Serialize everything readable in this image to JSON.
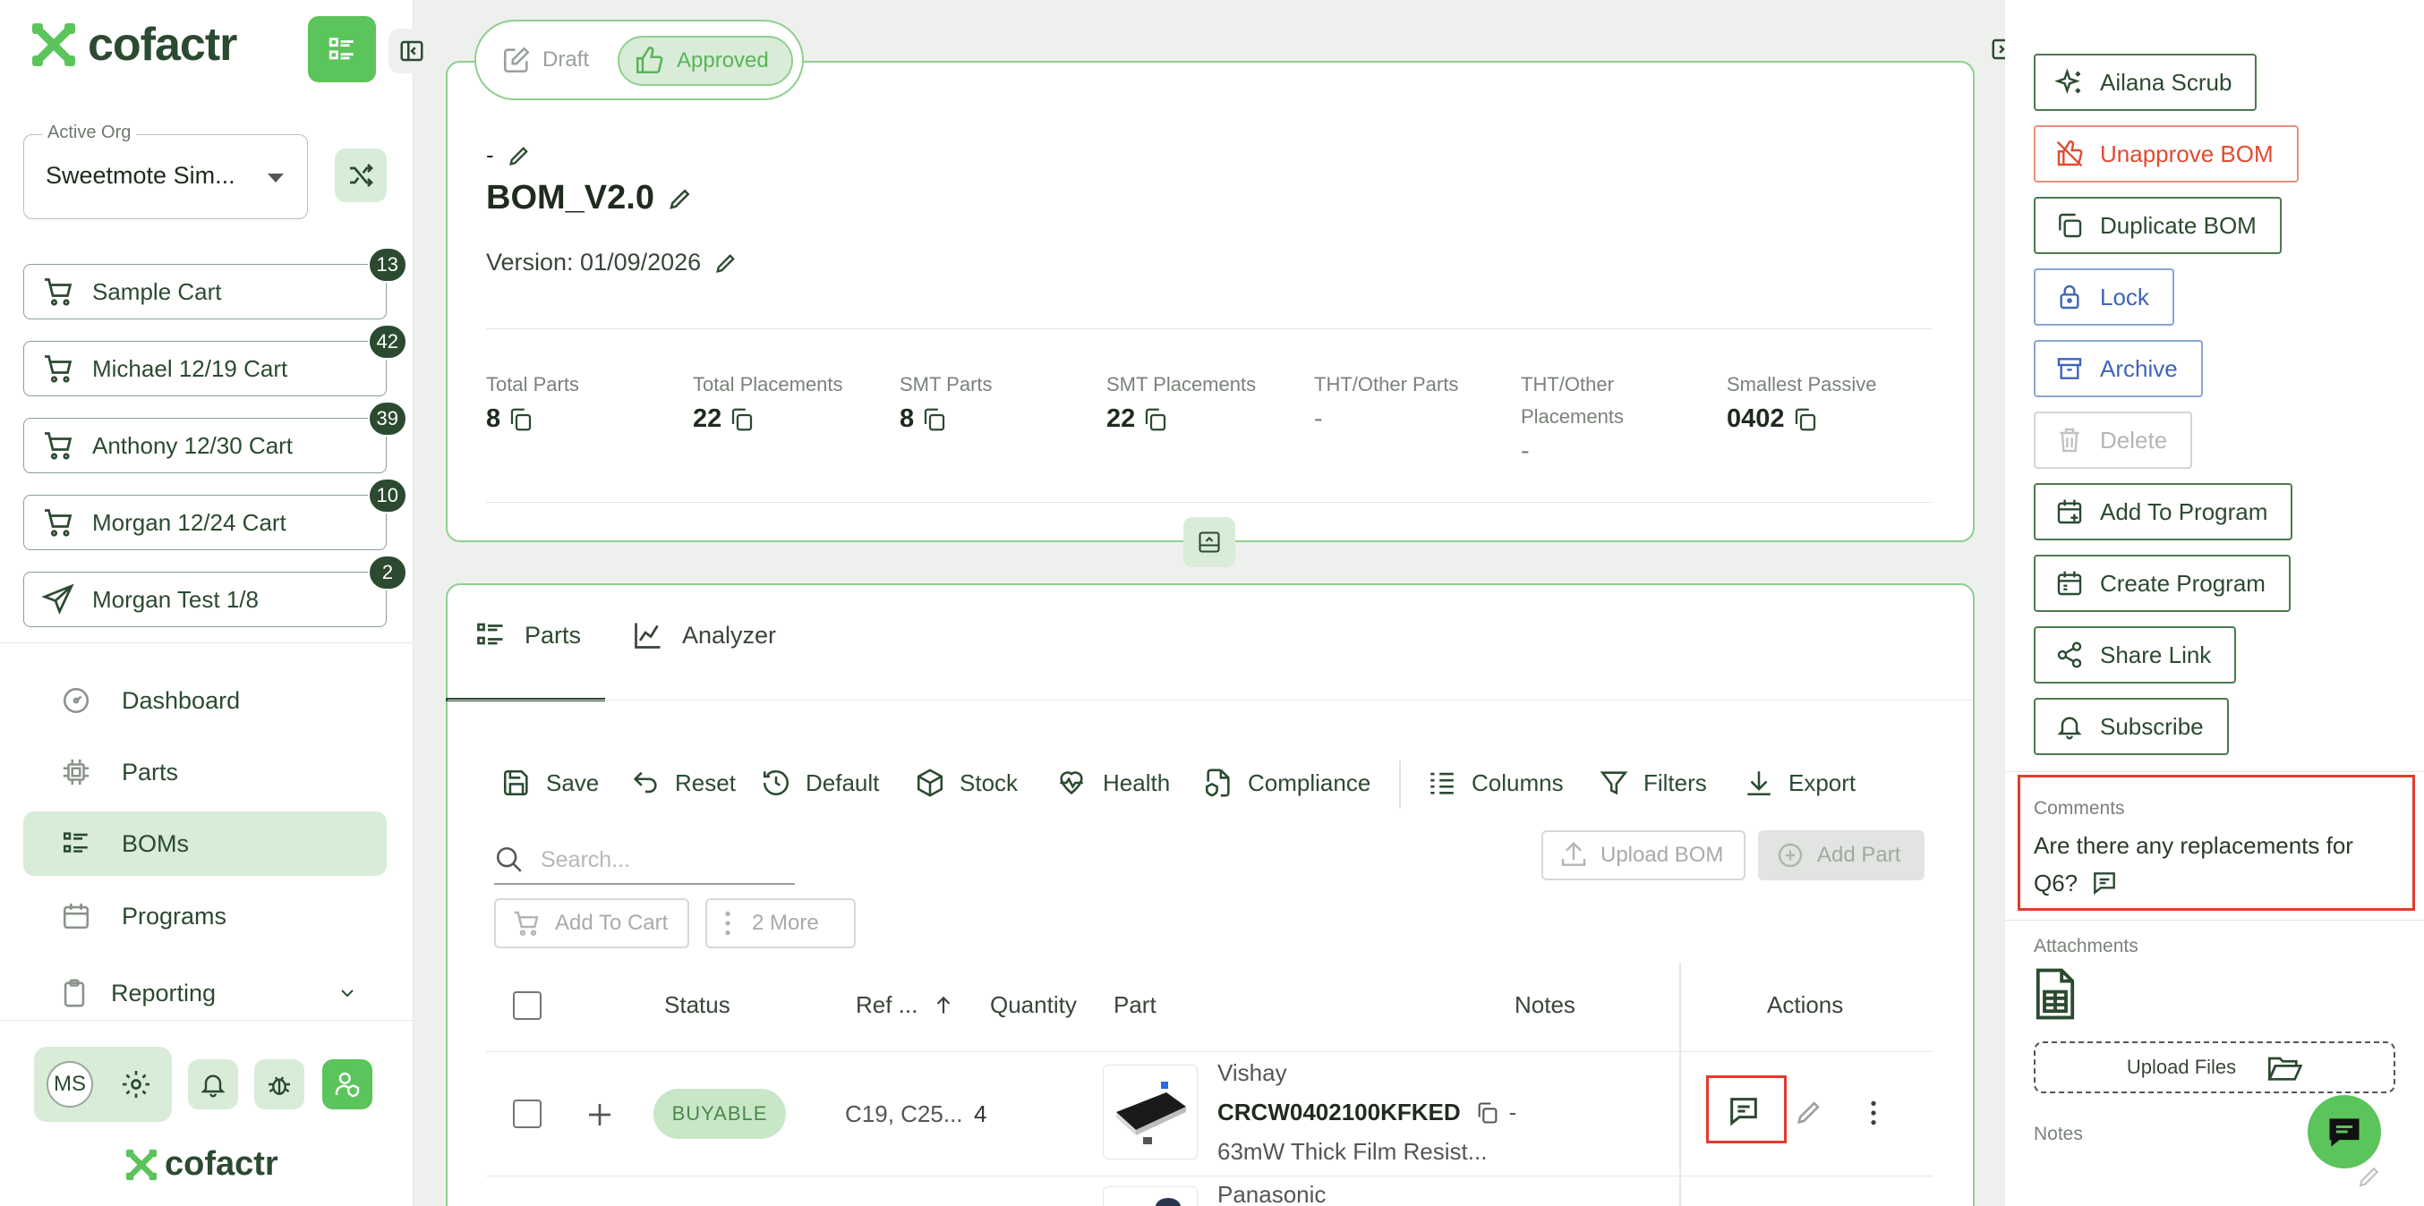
{
  "brand": {
    "name": "cofactr",
    "color": "#2b4a30",
    "accent": "#5bc45b"
  },
  "sidebar": {
    "org": {
      "label": "Active Org",
      "value": "Sweetmote Sim..."
    },
    "carts": [
      {
        "label": "Sample Cart",
        "count": "13",
        "icon": "cart-icon"
      },
      {
        "label": "Michael 12/19 Cart",
        "count": "42",
        "icon": "cart-icon"
      },
      {
        "label": "Anthony 12/30 Cart",
        "count": "39",
        "icon": "cart-icon"
      },
      {
        "label": "Morgan 12/24 Cart",
        "count": "10",
        "icon": "cart-icon"
      },
      {
        "label": "Morgan Test 1/8",
        "count": "2",
        "icon": "send-icon"
      }
    ],
    "nav": [
      {
        "label": "Dashboard",
        "icon": "dashboard-icon"
      },
      {
        "label": "Parts",
        "icon": "chip-icon"
      },
      {
        "label": "BOMs",
        "icon": "list-icon",
        "active": true
      },
      {
        "label": "Programs",
        "icon": "calendar-icon"
      },
      {
        "label": "Reporting",
        "icon": "clipboard-icon"
      }
    ],
    "user_initials": "MS"
  },
  "bom": {
    "status": {
      "draft": "Draft",
      "approved": "Approved"
    },
    "dash": "-",
    "title": "BOM_V2.0",
    "version": "Version: 01/09/2026",
    "stats": [
      {
        "label": "Total Parts",
        "value": "8",
        "copy": true
      },
      {
        "label": "Total Placements",
        "value": "22",
        "copy": true
      },
      {
        "label": "SMT Parts",
        "value": "8",
        "copy": true
      },
      {
        "label": "SMT Placements",
        "value": "22",
        "copy": true
      },
      {
        "label": "THT/Other Parts",
        "value": "-",
        "copy": false
      },
      {
        "label": "THT/Other Placements",
        "value": "-",
        "copy": false
      },
      {
        "label": "Smallest Passive",
        "value": "0402",
        "copy": true
      }
    ]
  },
  "tabs": {
    "parts": "Parts",
    "analyzer": "Analyzer"
  },
  "toolbar": {
    "save": "Save",
    "reset": "Reset",
    "default": "Default",
    "stock": "Stock",
    "health": "Health",
    "compliance": "Compliance",
    "columns": "Columns",
    "filters": "Filters",
    "export": "Export"
  },
  "search": {
    "placeholder": "Search..."
  },
  "actions": {
    "upload_bom": "Upload BOM",
    "add_part": "Add Part",
    "add_to_cart": "Add To Cart",
    "more": "2 More"
  },
  "table": {
    "headers": {
      "status": "Status",
      "ref": "Ref ...",
      "quantity": "Quantity",
      "part": "Part",
      "notes": "Notes",
      "actions": "Actions"
    },
    "rows": [
      {
        "status": "BUYABLE",
        "ref": "C19, C25...",
        "quantity": "4",
        "manufacturer": "Vishay",
        "mpn": "CRCW0402100KFKED",
        "description": "63mW Thick Film Resist...",
        "notes": "-"
      },
      {
        "manufacturer": "Panasonic"
      }
    ]
  },
  "right_panel": {
    "actions": {
      "scrub": "Ailana Scrub",
      "unapprove": "Unapprove BOM",
      "duplicate": "Duplicate BOM",
      "lock": "Lock",
      "archive": "Archive",
      "delete": "Delete",
      "add_program": "Add To Program",
      "create_program": "Create Program",
      "share": "Share Link",
      "subscribe": "Subscribe"
    },
    "comments": {
      "label": "Comments",
      "line1": "Are there any replacements for",
      "line2": "Q6?"
    },
    "attachments": {
      "label": "Attachments",
      "upload": "Upload Files"
    },
    "notes_label": "Notes"
  },
  "colors": {
    "danger": "#e24a2e",
    "info": "#3f64b8",
    "highlight": "#e23b2e"
  }
}
